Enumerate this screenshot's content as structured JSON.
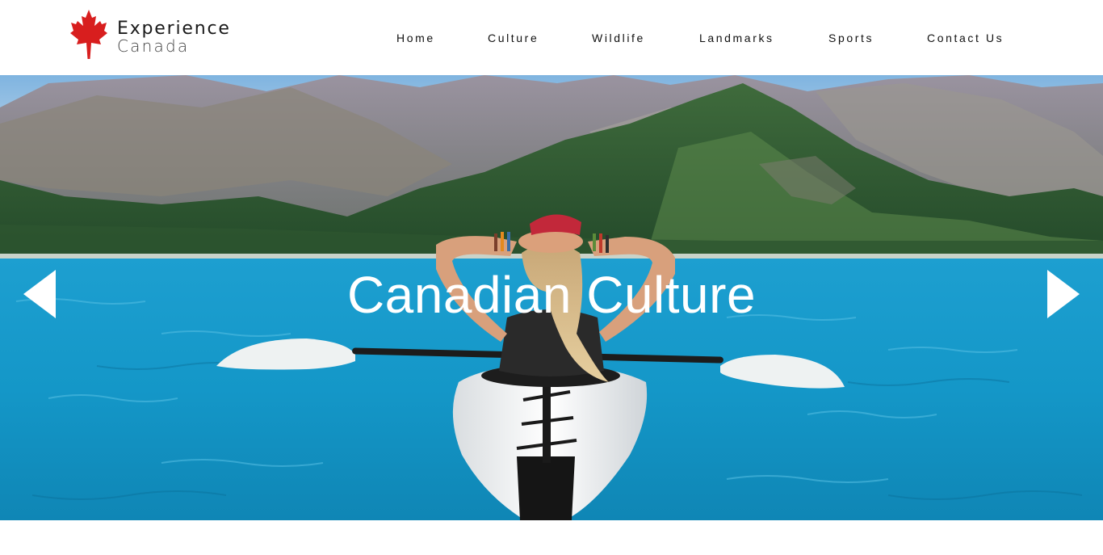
{
  "brand": {
    "line1": "Experience",
    "line2": "Canada",
    "leaf_color": "#d81e1e"
  },
  "nav": {
    "items": [
      "Home",
      "Culture",
      "Wildlife",
      "Landmarks",
      "Sports",
      "Contact Us"
    ]
  },
  "hero": {
    "title": "Canadian Culture",
    "prev_icon": "triangle-left-icon",
    "next_icon": "triangle-right-icon"
  },
  "colors": {
    "water": "#1aa3d4",
    "text": "#111111"
  }
}
